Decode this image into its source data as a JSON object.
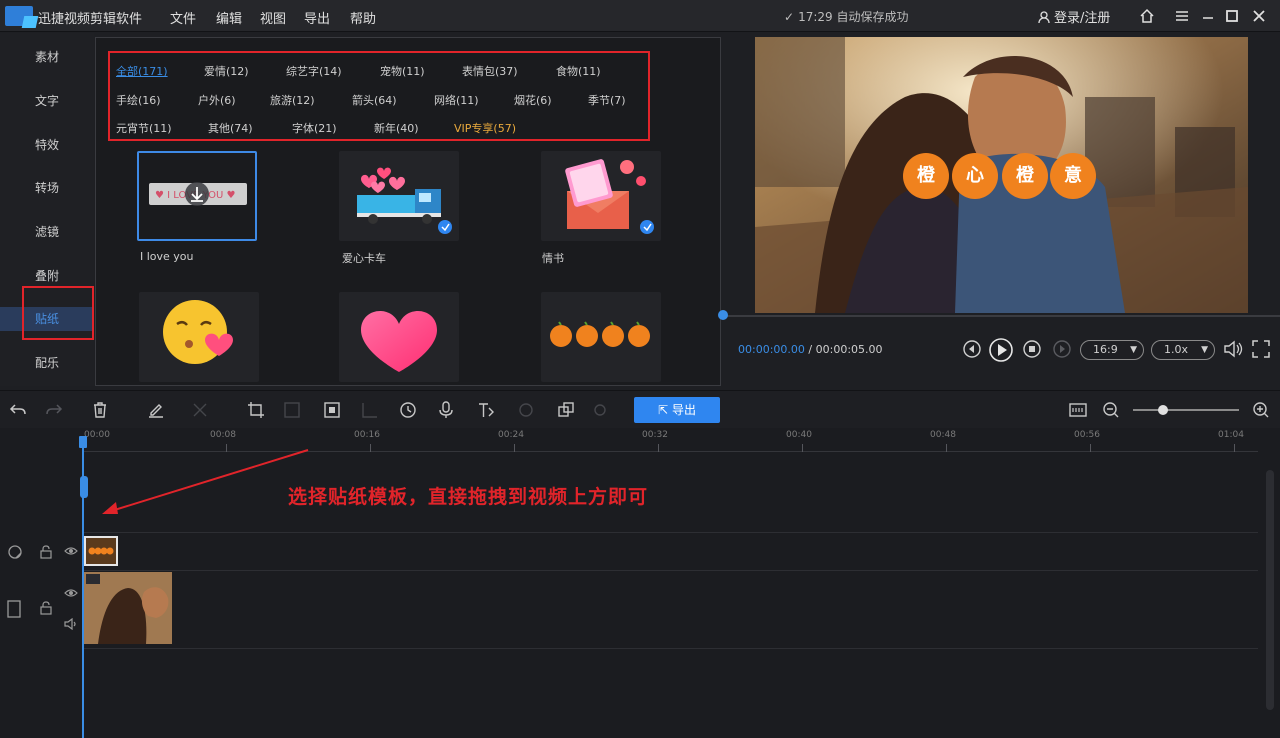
{
  "app": {
    "name": "迅捷视频剪辑软件"
  },
  "menu": [
    "文件",
    "编辑",
    "视图",
    "导出",
    "帮助"
  ],
  "save_status": "17:29 自动保存成功",
  "login": "登录/注册",
  "sidebar": {
    "items": [
      {
        "label": "素材"
      },
      {
        "label": "文字"
      },
      {
        "label": "特效"
      },
      {
        "label": "转场"
      },
      {
        "label": "滤镜"
      },
      {
        "label": "叠附"
      },
      {
        "label": "贴纸"
      },
      {
        "label": "配乐"
      }
    ],
    "active_index": 6
  },
  "categories": {
    "row1": [
      "全部(171)",
      "爱情(12)",
      "综艺字(14)",
      "宠物(11)",
      "表情包(37)",
      "食物(11)"
    ],
    "row2": [
      "手绘(16)",
      "户外(6)",
      "旅游(12)",
      "箭头(64)",
      "网络(11)",
      "烟花(6)",
      "季节(7)"
    ],
    "row3": [
      "元宵节(11)",
      "其他(74)",
      "字体(21)",
      "新年(40)",
      "VIP专享(57)"
    ]
  },
  "stickers": [
    {
      "label": "I love you"
    },
    {
      "label": "爱心卡车"
    },
    {
      "label": "情书"
    },
    {
      "label": ""
    },
    {
      "label": ""
    },
    {
      "label": ""
    }
  ],
  "preview": {
    "overlay_chars": [
      "橙",
      "心",
      "橙",
      "意"
    ]
  },
  "player": {
    "current": "00:00:00.00",
    "separator": "/",
    "total": "00:00:05.00",
    "aspect": "16:9",
    "speed": "1.0x"
  },
  "toolbar": {
    "export_label": "导出"
  },
  "timeline": {
    "ruler": [
      "00:00",
      "00:08",
      "00:16",
      "00:24",
      "00:32",
      "00:40",
      "00:48",
      "00:56",
      "01:04"
    ],
    "annotation": "选择贴纸模板，直接拖拽到视频上方即可"
  },
  "colors": {
    "accent": "#2f86f0",
    "highlight_red": "#e1242a",
    "vip": "#e9a93c"
  }
}
